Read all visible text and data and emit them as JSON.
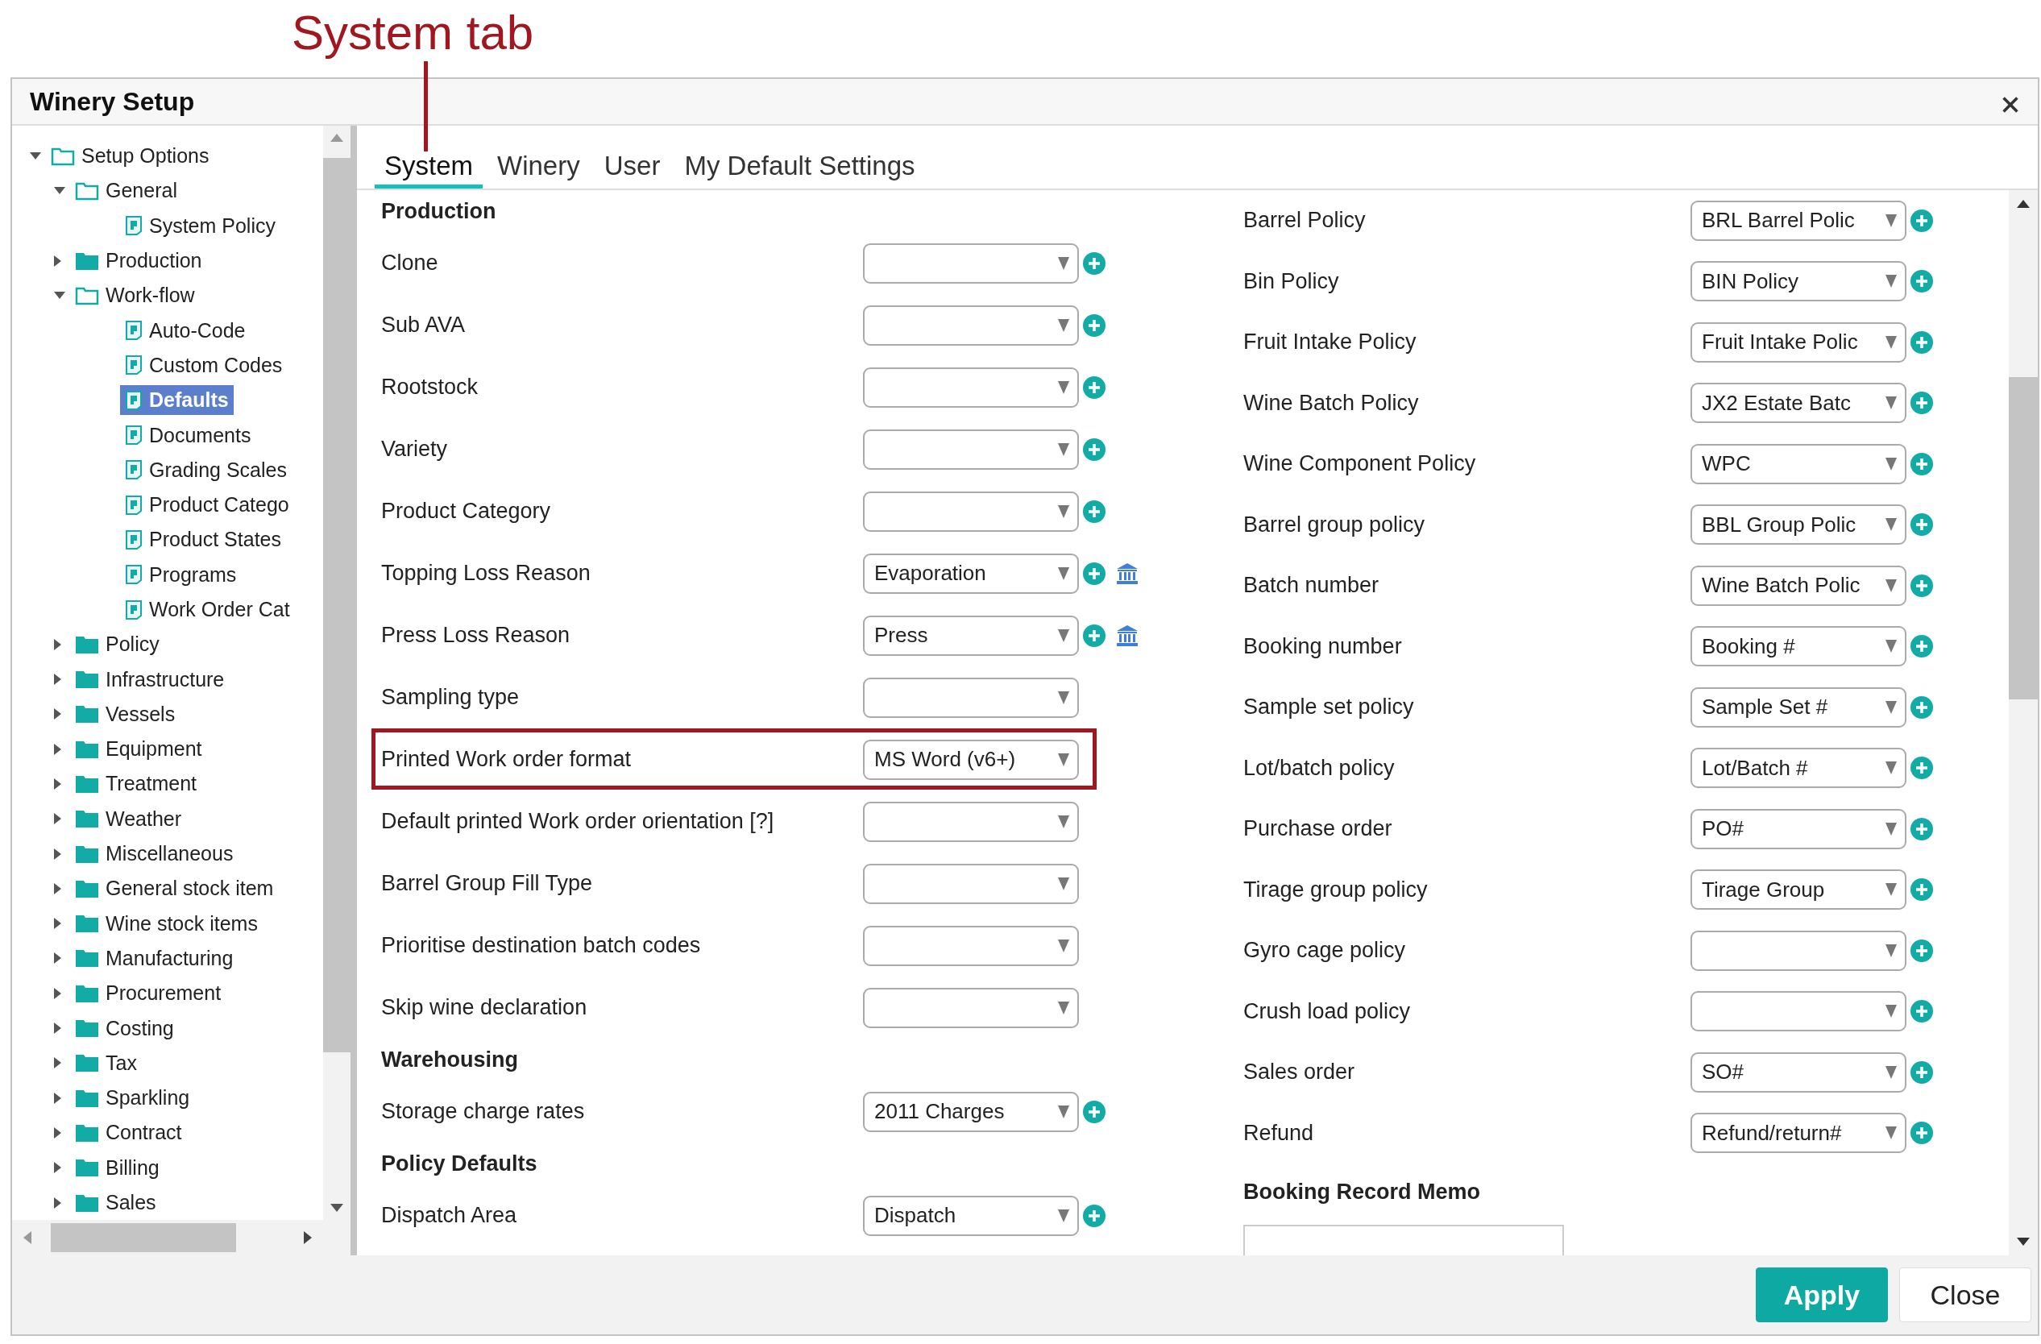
{
  "annotation": {
    "label": "System tab"
  },
  "window": {
    "title": "Winery Setup"
  },
  "tree": [
    {
      "label": "Setup Options",
      "kind": "folder",
      "expanded": true,
      "selected": false,
      "children": [
        {
          "label": "General",
          "kind": "folder",
          "expanded": true,
          "selected": false,
          "children": [
            {
              "label": "System Policy",
              "kind": "page",
              "selected": false
            }
          ]
        },
        {
          "label": "Production",
          "kind": "folder",
          "expanded": false,
          "selected": false
        },
        {
          "label": "Work-flow",
          "kind": "folder",
          "expanded": true,
          "selected": false,
          "children": [
            {
              "label": "Auto-Code",
              "kind": "page",
              "selected": false
            },
            {
              "label": "Custom Codes",
              "kind": "page",
              "selected": false
            },
            {
              "label": "Defaults",
              "kind": "page",
              "selected": true
            },
            {
              "label": "Documents",
              "kind": "page",
              "selected": false
            },
            {
              "label": "Grading Scales",
              "kind": "page",
              "selected": false
            },
            {
              "label": "Product Catego",
              "kind": "page",
              "selected": false
            },
            {
              "label": "Product States",
              "kind": "page",
              "selected": false
            },
            {
              "label": "Programs",
              "kind": "page",
              "selected": false
            },
            {
              "label": "Work Order Cat",
              "kind": "page",
              "selected": false
            }
          ]
        },
        {
          "label": "Policy",
          "kind": "folder",
          "expanded": false,
          "selected": false
        },
        {
          "label": "Infrastructure",
          "kind": "folder",
          "expanded": false,
          "selected": false
        },
        {
          "label": "Vessels",
          "kind": "folder",
          "expanded": false,
          "selected": false
        },
        {
          "label": "Equipment",
          "kind": "folder",
          "expanded": false,
          "selected": false
        },
        {
          "label": "Treatment",
          "kind": "folder",
          "expanded": false,
          "selected": false
        },
        {
          "label": "Weather",
          "kind": "folder",
          "expanded": false,
          "selected": false
        },
        {
          "label": "Miscellaneous",
          "kind": "folder",
          "expanded": false,
          "selected": false
        },
        {
          "label": "General stock item",
          "kind": "folder",
          "expanded": false,
          "selected": false
        },
        {
          "label": "Wine stock items",
          "kind": "folder",
          "expanded": false,
          "selected": false
        },
        {
          "label": "Manufacturing",
          "kind": "folder",
          "expanded": false,
          "selected": false
        },
        {
          "label": "Procurement",
          "kind": "folder",
          "expanded": false,
          "selected": false
        },
        {
          "label": "Costing",
          "kind": "folder",
          "expanded": false,
          "selected": false
        },
        {
          "label": "Tax",
          "kind": "folder",
          "expanded": false,
          "selected": false
        },
        {
          "label": "Sparkling",
          "kind": "folder",
          "expanded": false,
          "selected": false
        },
        {
          "label": "Contract",
          "kind": "folder",
          "expanded": false,
          "selected": false
        },
        {
          "label": "Billing",
          "kind": "folder",
          "expanded": false,
          "selected": false
        },
        {
          "label": "Sales",
          "kind": "folder",
          "expanded": false,
          "selected": false
        }
      ]
    }
  ],
  "tabs": [
    {
      "label": "System",
      "selected": true
    },
    {
      "label": "Winery",
      "selected": false
    },
    {
      "label": "User",
      "selected": false
    },
    {
      "label": "My Default Settings",
      "selected": false
    }
  ],
  "left_form": [
    {
      "kind": "section",
      "label": "Production"
    },
    {
      "kind": "field",
      "label": "Clone",
      "add": true,
      "lookup": false,
      "highlighted": false
    },
    {
      "kind": "field",
      "label": "Sub AVA",
      "add": true,
      "lookup": false,
      "highlighted": false
    },
    {
      "kind": "field",
      "label": "Rootstock",
      "add": true,
      "lookup": false,
      "highlighted": false
    },
    {
      "kind": "field",
      "label": "Variety",
      "add": true,
      "lookup": false,
      "highlighted": false
    },
    {
      "kind": "field",
      "label": "Product Category",
      "add": true,
      "lookup": false,
      "highlighted": false
    },
    {
      "kind": "field",
      "label": "Topping Loss Reason",
      "value": "Evaporation",
      "add": true,
      "lookup": true,
      "highlighted": false
    },
    {
      "kind": "field",
      "label": "Press Loss Reason",
      "value": "Press",
      "add": true,
      "lookup": true,
      "highlighted": false
    },
    {
      "kind": "field",
      "label": "Sampling type",
      "add": false,
      "lookup": false,
      "highlighted": false
    },
    {
      "kind": "field",
      "label": "Printed Work order format",
      "value": "MS Word (v6+)",
      "add": false,
      "lookup": false,
      "highlighted": true
    },
    {
      "kind": "field",
      "label": "Default printed Work order orientation [?]",
      "add": false,
      "lookup": false,
      "highlighted": false
    },
    {
      "kind": "field",
      "label": "Barrel Group Fill Type",
      "add": false,
      "lookup": false,
      "highlighted": false
    },
    {
      "kind": "field",
      "label": "Prioritise destination batch codes",
      "add": false,
      "lookup": false,
      "highlighted": false
    },
    {
      "kind": "field",
      "label": "Skip wine declaration",
      "add": false,
      "lookup": false,
      "highlighted": false
    },
    {
      "kind": "section",
      "label": "Warehousing"
    },
    {
      "kind": "field",
      "label": "Storage charge rates",
      "value": "2011 Charges",
      "add": true,
      "lookup": false,
      "highlighted": false
    },
    {
      "kind": "section",
      "label": "Policy Defaults"
    },
    {
      "kind": "field",
      "label": "Dispatch Area",
      "value": "Dispatch",
      "add": true,
      "lookup": false,
      "highlighted": false
    }
  ],
  "right_form": [
    {
      "kind": "field",
      "label": "Barrel Policy",
      "value": "BRL Barrel Polic",
      "add": true
    },
    {
      "kind": "field",
      "label": "Bin Policy",
      "value": "BIN Policy",
      "add": true
    },
    {
      "kind": "field",
      "label": "Fruit Intake Policy",
      "value": "Fruit Intake Polic",
      "add": true
    },
    {
      "kind": "field",
      "label": "Wine Batch Policy",
      "value": "JX2 Estate Batc",
      "add": true
    },
    {
      "kind": "field",
      "label": "Wine Component Policy",
      "value": "WPC",
      "add": true
    },
    {
      "kind": "field",
      "label": "Barrel group policy",
      "value": "BBL Group Polic",
      "add": true
    },
    {
      "kind": "field",
      "label": "Batch number",
      "value": "Wine Batch Polic",
      "add": true
    },
    {
      "kind": "field",
      "label": "Booking number",
      "value": "Booking #",
      "add": true
    },
    {
      "kind": "field",
      "label": "Sample set policy",
      "value": "Sample Set #",
      "add": true
    },
    {
      "kind": "field",
      "label": "Lot/batch policy",
      "value": "Lot/Batch #",
      "add": true
    },
    {
      "kind": "field",
      "label": "Purchase order",
      "value": "PO#",
      "add": true
    },
    {
      "kind": "field",
      "label": "Tirage group policy",
      "value": "Tirage Group",
      "add": true
    },
    {
      "kind": "field",
      "label": "Gyro cage policy",
      "add": true
    },
    {
      "kind": "field",
      "label": "Crush load policy",
      "add": true
    },
    {
      "kind": "field",
      "label": "Sales order",
      "value": "SO#",
      "add": true
    },
    {
      "kind": "field",
      "label": "Refund",
      "value": "Refund/return#",
      "add": true
    },
    {
      "kind": "section",
      "label": "Booking Record Memo"
    },
    {
      "kind": "memo"
    }
  ],
  "buttons": [
    {
      "label": "Apply",
      "kind": "primary"
    },
    {
      "label": "Close",
      "kind": "secondary"
    }
  ]
}
